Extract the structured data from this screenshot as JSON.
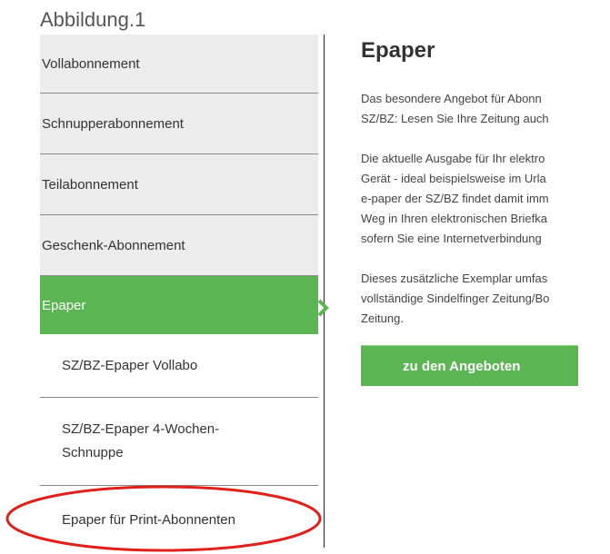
{
  "figure": {
    "caption": "Abbildung.1"
  },
  "sidebar": {
    "items": [
      {
        "label": "Vollabonnement"
      },
      {
        "label": "Schnupperabonnement"
      },
      {
        "label": "Teilabonnement"
      },
      {
        "label": "Geschenk-Abonnement"
      },
      {
        "label": "Epaper",
        "active": true
      }
    ],
    "subitems": [
      {
        "label": "SZ/BZ-Epaper Vollabo"
      },
      {
        "label": "SZ/BZ-Epaper 4-Wochen-Schnuppe"
      },
      {
        "label": "Epaper für Print-Abonnenten",
        "highlighted": true
      }
    ]
  },
  "main": {
    "title": "Epaper",
    "paragraph1": [
      "Das besondere Angebot für Abonn",
      "SZ/BZ: Lesen Sie Ihre Zeitung auch"
    ],
    "paragraph2": [
      "Die aktuelle Ausgabe für Ihr elektro",
      "Gerät - ideal beispielsweise im Urla",
      "e-paper der SZ/BZ findet damit imm",
      "Weg in Ihren elektronischen Briefka",
      "sofern Sie eine Internetverbindung"
    ],
    "paragraph3": [
      "Dieses zusätzliche Exemplar umfas",
      "vollständige Sindelfinger Zeitung/Bo",
      "Zeitung."
    ],
    "button_label": "zu den Angeboten"
  },
  "colors": {
    "accent_green": "#5ab552",
    "nav_background": "#ececec",
    "highlight_ellipse": "#e0201b"
  },
  "icons": {
    "active_arrow": "chevron-right-icon"
  }
}
